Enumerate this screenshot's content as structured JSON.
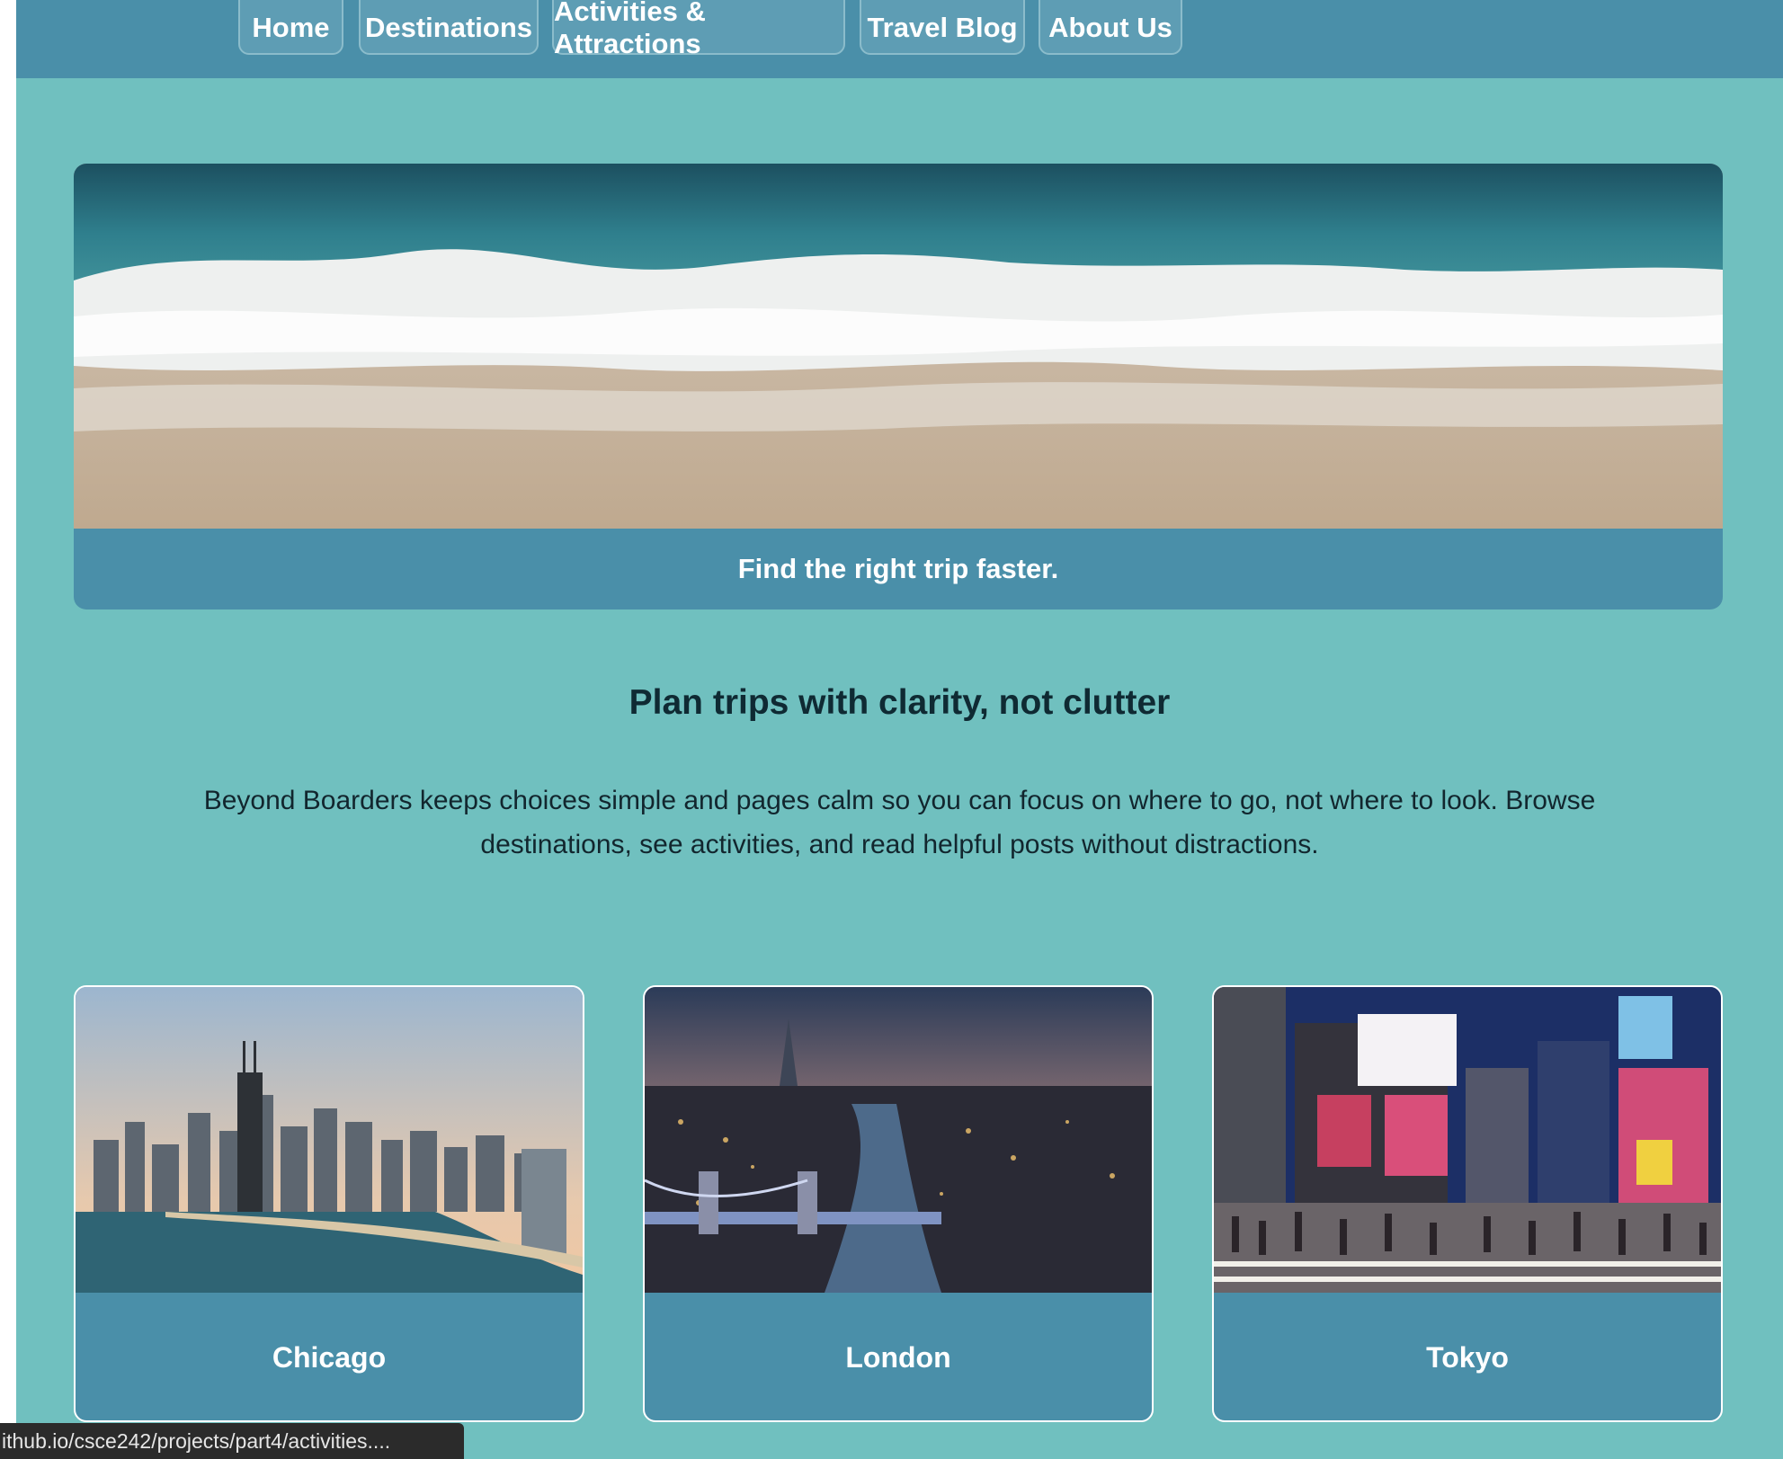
{
  "nav": {
    "items": [
      {
        "label": "Home"
      },
      {
        "label": "Destinations"
      },
      {
        "label": "Activities & Attractions"
      },
      {
        "label": "Travel Blog"
      },
      {
        "label": "About Us"
      }
    ]
  },
  "hero": {
    "image": "ocean-waves-beach-photo",
    "caption": "Find the right trip faster."
  },
  "intro": {
    "heading": "Plan trips with clarity, not clutter",
    "body": "Beyond Boarders keeps choices simple and pages calm so you can focus on where to go, not where to look. Browse destinations, see activities, and read helpful posts without distractions."
  },
  "cards": [
    {
      "label": "Chicago",
      "image": "chicago-skyline-photo"
    },
    {
      "label": "London",
      "image": "london-tower-bridge-photo"
    },
    {
      "label": "Tokyo",
      "image": "tokyo-shibuya-crossing-photo"
    }
  ],
  "status_bar": {
    "url": "ithub.io/csce242/projects/part4/activities...."
  },
  "colors": {
    "page_background": "#70c0bf",
    "nav_background": "#4a8fa9",
    "card_background": "#4a8fa9",
    "heading_text": "#0f2a33"
  }
}
